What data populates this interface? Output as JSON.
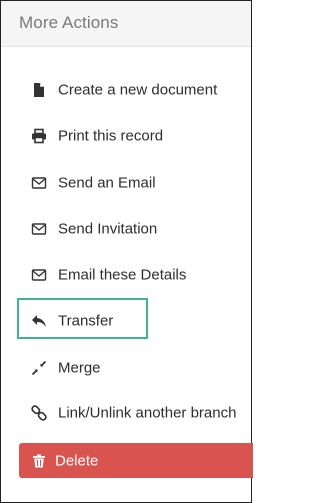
{
  "panel": {
    "title": "More Actions"
  },
  "menu": {
    "items": [
      {
        "label": "Create a new document",
        "icon": "file-icon"
      },
      {
        "label": "Print this record",
        "icon": "printer-icon"
      },
      {
        "label": "Send an Email",
        "icon": "envelope-icon"
      },
      {
        "label": "Send Invitation",
        "icon": "envelope-icon"
      },
      {
        "label": "Email these Details",
        "icon": "envelope-icon"
      },
      {
        "label": "Transfer",
        "icon": "reply-arrow-icon",
        "highlighted": true
      },
      {
        "label": "Merge",
        "icon": "compress-arrows-icon"
      },
      {
        "label": "Link/Unlink another branch",
        "icon": "link-icon"
      }
    ]
  },
  "delete": {
    "label": "Delete",
    "icon": "trash-icon"
  },
  "colors": {
    "header_bg": "#f5f5f5",
    "title_text": "#7a7a7a",
    "item_text": "#2e2e2e",
    "highlight_border": "#3fb58f",
    "delete_bg": "#d9534f",
    "delete_text": "#ffffff"
  }
}
